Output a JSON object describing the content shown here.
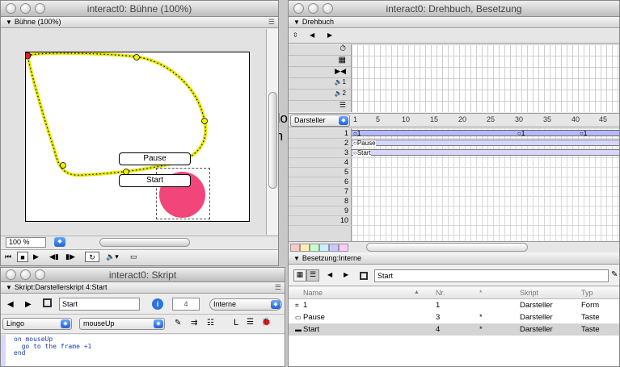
{
  "stage_window": {
    "title": "interact0: Bühne (100%)",
    "pane_title": "Bühne (100%)",
    "buttons": {
      "pause": "Pause",
      "start": "Start"
    },
    "zoom": "100 %"
  },
  "script_window": {
    "title": "interact0: Skript",
    "pane_title": "Skript:Darstellerskript 4:Start",
    "member_name": "Start",
    "member_number": "4",
    "cast_select": "Interne",
    "language_select": "Lingo",
    "handler_select": "mouseUp",
    "code_lines": [
      "on mouseUp",
      "  go to the frame +1",
      "end"
    ]
  },
  "score_window": {
    "title": "interact0: Drehbuch, Besetzung",
    "pane_title": "Drehbuch",
    "sprite_select": "Darsteller",
    "frame_numbers": [
      "1",
      "5",
      "10",
      "15",
      "20",
      "25",
      "30",
      "35",
      "40",
      "45"
    ],
    "channel_numbers": [
      "1",
      "2",
      "3",
      "4",
      "5",
      "6",
      "7",
      "8",
      "9",
      "10"
    ],
    "sprites": [
      {
        "label": "1",
        "end_label": "1",
        "mid_label": "1"
      },
      {
        "label": "Pause"
      },
      {
        "label": "Start"
      }
    ],
    "special_channels": [
      "tempo",
      "palette",
      "transition",
      "sound 1",
      "sound 2",
      "script"
    ],
    "sound_labels": [
      "1",
      "2"
    ]
  },
  "cast_window": {
    "pane_title": "Besetzung:Interne",
    "member_field": "Start",
    "columns": [
      "Name",
      "Nr.",
      "*",
      "Skript",
      "Typ"
    ],
    "rows": [
      {
        "name": "1",
        "nr": "1",
        "star": "",
        "script": "Darsteller",
        "type": "Form"
      },
      {
        "name": "Pause",
        "nr": "3",
        "star": "*",
        "script": "Darsteller",
        "type": "Taste"
      },
      {
        "name": "Start",
        "nr": "4",
        "star": "*",
        "script": "Darsteller",
        "type": "Taste"
      }
    ]
  },
  "background_text": [
    "do",
    "in"
  ]
}
